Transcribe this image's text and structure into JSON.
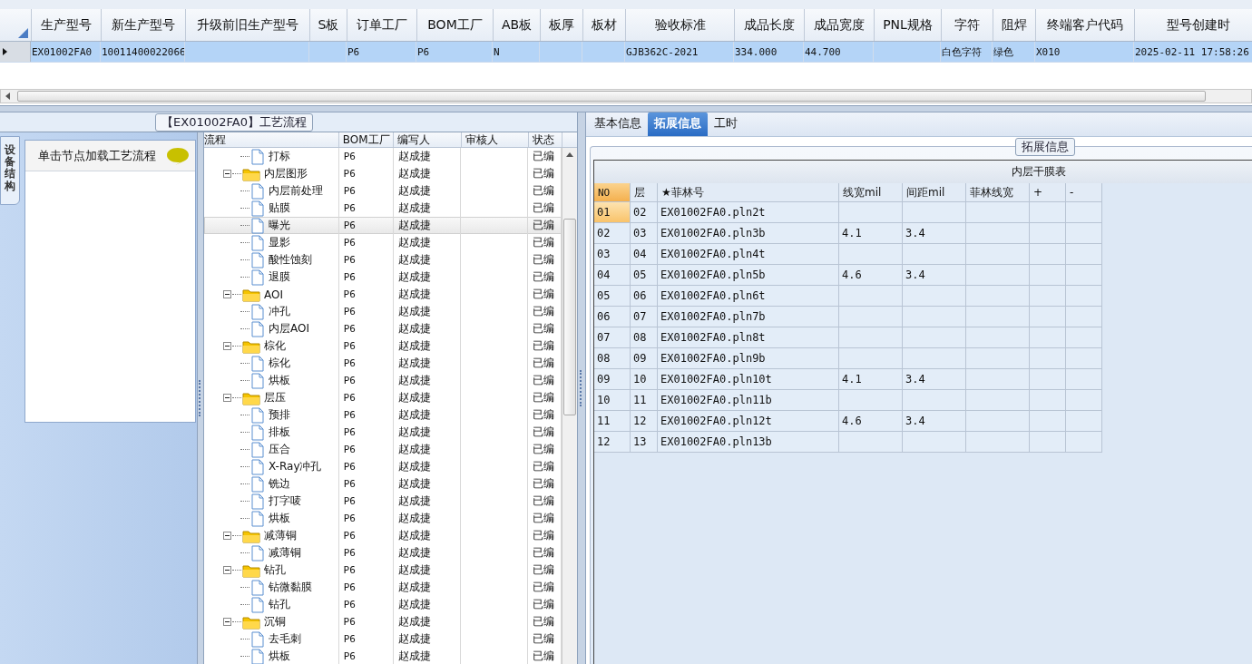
{
  "top_grid": {
    "columns": [
      "生产型号",
      "新生产型号",
      "升级前旧生产型号",
      "S板",
      "订单工厂",
      "BOM工厂",
      "AB板",
      "板厚",
      "板材",
      "验收标准",
      "成品长度",
      "成品宽度",
      "PNL规格",
      "字符",
      "阻焊",
      "终端客户代码",
      "型号创建时"
    ],
    "rows": [
      {
        "selected": true,
        "cells": [
          "EX01002FA0",
          "10011400022066",
          null,
          null,
          "P6",
          "P6",
          "N",
          null,
          null,
          "GJB362C-2021",
          "334.000",
          "44.700",
          null,
          "白色字符",
          "绿色",
          "X010",
          "2025-02-11 17:58:26"
        ]
      }
    ]
  },
  "process_panel": {
    "legend": "【EX01002FA0】工艺流程",
    "side_tab": {
      "label": "设备结构",
      "selected": true
    },
    "hint": "单击节点加载工艺流程",
    "tree_columns": [
      "流程",
      "BOM工厂",
      "编写人",
      "审核人",
      "状态"
    ],
    "tree": [
      {
        "label": "打标",
        "kind": "file",
        "bom": "P6",
        "writer": "赵成捷",
        "status": "已编",
        "selected": false
      },
      {
        "label": "内层图形",
        "kind": "folder",
        "expanded": true,
        "bom": "P6",
        "writer": "赵成捷",
        "status": "已编",
        "selected": false,
        "children": [
          {
            "label": "内层前处理",
            "kind": "file",
            "bom": "P6",
            "writer": "赵成捷",
            "status": "已编",
            "selected": false
          },
          {
            "label": "贴膜",
            "kind": "file",
            "bom": "P6",
            "writer": "赵成捷",
            "status": "已编",
            "selected": false
          },
          {
            "label": "曝光",
            "kind": "file",
            "bom": "P6",
            "writer": "赵成捷",
            "status": "已编",
            "selected": true
          },
          {
            "label": "显影",
            "kind": "file",
            "bom": "P6",
            "writer": "赵成捷",
            "status": "已编",
            "selected": false
          },
          {
            "label": "酸性蚀刻",
            "kind": "file",
            "bom": "P6",
            "writer": "赵成捷",
            "status": "已编",
            "selected": false
          },
          {
            "label": "退膜",
            "kind": "file",
            "bom": "P6",
            "writer": "赵成捷",
            "status": "已编",
            "selected": false
          }
        ]
      },
      {
        "label": "AOI",
        "kind": "folder",
        "expanded": true,
        "bom": "P6",
        "writer": "赵成捷",
        "status": "已编",
        "selected": false,
        "children": [
          {
            "label": "冲孔",
            "kind": "file",
            "bom": "P6",
            "writer": "赵成捷",
            "status": "已编",
            "selected": false
          },
          {
            "label": "内层AOI",
            "kind": "file",
            "bom": "P6",
            "writer": "赵成捷",
            "status": "已编",
            "selected": false
          }
        ]
      },
      {
        "label": "棕化",
        "kind": "folder",
        "expanded": true,
        "bom": "P6",
        "writer": "赵成捷",
        "status": "已编",
        "selected": false,
        "children": [
          {
            "label": "棕化",
            "kind": "file",
            "bom": "P6",
            "writer": "赵成捷",
            "status": "已编",
            "selected": false
          },
          {
            "label": "烘板",
            "kind": "file",
            "bom": "P6",
            "writer": "赵成捷",
            "status": "已编",
            "selected": false
          }
        ]
      },
      {
        "label": "层压",
        "kind": "folder",
        "expanded": true,
        "bom": "P6",
        "writer": "赵成捷",
        "status": "已编",
        "selected": false,
        "children": [
          {
            "label": "预排",
            "kind": "file",
            "bom": "P6",
            "writer": "赵成捷",
            "status": "已编",
            "selected": false
          },
          {
            "label": "排板",
            "kind": "file",
            "bom": "P6",
            "writer": "赵成捷",
            "status": "已编",
            "selected": false
          },
          {
            "label": "压合",
            "kind": "file",
            "bom": "P6",
            "writer": "赵成捷",
            "status": "已编",
            "selected": false
          },
          {
            "label": "X-Ray冲孔",
            "kind": "file",
            "bom": "P6",
            "writer": "赵成捷",
            "status": "已编",
            "selected": false
          },
          {
            "label": "铣边",
            "kind": "file",
            "bom": "P6",
            "writer": "赵成捷",
            "status": "已编",
            "selected": false
          },
          {
            "label": "打字唛",
            "kind": "file",
            "bom": "P6",
            "writer": "赵成捷",
            "status": "已编",
            "selected": false
          },
          {
            "label": "烘板",
            "kind": "file",
            "bom": "P6",
            "writer": "赵成捷",
            "status": "已编",
            "selected": false
          }
        ]
      },
      {
        "label": "减薄铜",
        "kind": "folder",
        "expanded": true,
        "bom": "P6",
        "writer": "赵成捷",
        "status": "已编",
        "selected": false,
        "children": [
          {
            "label": "减薄铜",
            "kind": "file",
            "bom": "P6",
            "writer": "赵成捷",
            "status": "已编",
            "selected": false
          }
        ]
      },
      {
        "label": "钻孔",
        "kind": "folder",
        "expanded": true,
        "bom": "P6",
        "writer": "赵成捷",
        "status": "已编",
        "selected": false,
        "children": [
          {
            "label": "钻微黏膜",
            "kind": "file",
            "bom": "P6",
            "writer": "赵成捷",
            "status": "已编",
            "selected": false
          },
          {
            "label": "钻孔",
            "kind": "file",
            "bom": "P6",
            "writer": "赵成捷",
            "status": "已编",
            "selected": false
          }
        ]
      },
      {
        "label": "沉铜",
        "kind": "folder",
        "expanded": true,
        "bom": "P6",
        "writer": "赵成捷",
        "status": "已编",
        "selected": false,
        "children": [
          {
            "label": "去毛刺",
            "kind": "file",
            "bom": "P6",
            "writer": "赵成捷",
            "status": "已编",
            "selected": false
          },
          {
            "label": "烘板",
            "kind": "file",
            "bom": "P6",
            "writer": "赵成捷",
            "status": "已编",
            "selected": false
          }
        ]
      }
    ]
  },
  "detail_panel": {
    "tabs": [
      {
        "label": "基本信息",
        "selected": false
      },
      {
        "label": "拓展信息",
        "selected": true
      },
      {
        "label": "工时",
        "selected": false
      }
    ],
    "legend": "拓展信息",
    "table_title": "内层干膜表",
    "columns": [
      "NO",
      "层",
      "★菲林号",
      "线宽mil",
      "间距mil",
      "菲林线宽",
      "+",
      "-"
    ],
    "rows": [
      {
        "selected": true,
        "cells": [
          "01",
          "02",
          "EX01002FA0.pln2t",
          null,
          null
        ]
      },
      {
        "selected": false,
        "cells": [
          "02",
          "03",
          "EX01002FA0.pln3b",
          "4.1",
          "3.4"
        ]
      },
      {
        "selected": false,
        "cells": [
          "03",
          "04",
          "EX01002FA0.pln4t",
          null,
          null
        ]
      },
      {
        "selected": false,
        "cells": [
          "04",
          "05",
          "EX01002FA0.pln5b",
          "4.6",
          "3.4"
        ]
      },
      {
        "selected": false,
        "cells": [
          "05",
          "06",
          "EX01002FA0.pln6t",
          null,
          null
        ]
      },
      {
        "selected": false,
        "cells": [
          "06",
          "07",
          "EX01002FA0.pln7b",
          null,
          null
        ]
      },
      {
        "selected": false,
        "cells": [
          "07",
          "08",
          "EX01002FA0.pln8t",
          null,
          null
        ]
      },
      {
        "selected": false,
        "cells": [
          "08",
          "09",
          "EX01002FA0.pln9b",
          null,
          null
        ]
      },
      {
        "selected": false,
        "cells": [
          "09",
          "10",
          "EX01002FA0.pln10t",
          "4.1",
          "3.4"
        ]
      },
      {
        "selected": false,
        "cells": [
          "10",
          "11",
          "EX01002FA0.pln11b",
          null,
          null
        ]
      },
      {
        "selected": false,
        "cells": [
          "11",
          "12",
          "EX01002FA0.pln12t",
          "4.6",
          "3.4"
        ]
      },
      {
        "selected": false,
        "cells": [
          "12",
          "13",
          "EX01002FA0.pln13b",
          null,
          null
        ]
      }
    ]
  }
}
